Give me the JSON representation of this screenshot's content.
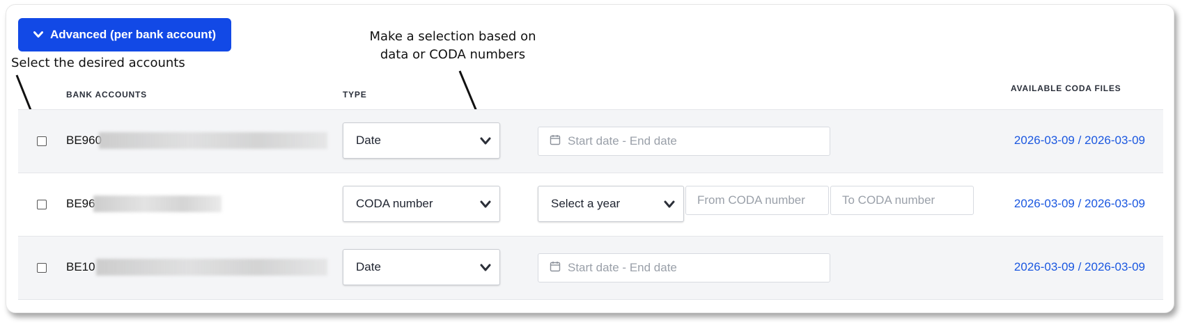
{
  "advanced_button": {
    "label": "Advanced (per bank account)"
  },
  "annotations": {
    "select_accounts": "Select the desired accounts",
    "selection_hint_line1": "Make a selection based on",
    "selection_hint_line2": "data or CODA numbers"
  },
  "table": {
    "headers": {
      "bank_accounts": "BANK ACCOUNTS",
      "type": "TYPE",
      "available_coda": "AVAILABLE CODA FILES"
    },
    "rows": [
      {
        "checked": false,
        "account": "BE960",
        "type": "Date",
        "range_placeholder": "Start date - End date",
        "coda_files": "2026-03-09 / 2026-03-09"
      },
      {
        "checked": false,
        "account": "BE96",
        "type": "CODA number",
        "year_placeholder": "Select a year",
        "from_placeholder": "From CODA number",
        "to_placeholder": "To CODA number",
        "coda_files": "2026-03-09 / 2026-03-09"
      },
      {
        "checked": false,
        "account": "BE10",
        "type": "Date",
        "range_placeholder": "Start date - End date",
        "coda_files": "2026-03-09 / 2026-03-09"
      }
    ]
  },
  "colors": {
    "primary": "#1249e6",
    "link": "#1a57e0",
    "row_alt": "#f4f5f7"
  },
  "icons": {
    "chevron": "chevron-down-icon",
    "calendar": "calendar-icon"
  }
}
